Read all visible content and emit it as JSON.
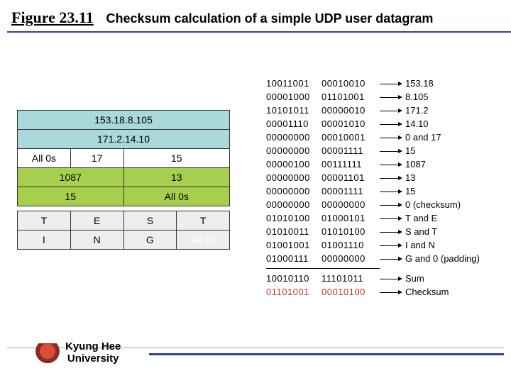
{
  "title": {
    "figure_label": "Figure 23.11",
    "caption": "Checksum calculation of a simple UDP user datagram"
  },
  "packet": {
    "src_ip": "153.18.8.105",
    "dst_ip": "171.2.14.10",
    "row3": {
      "a": "All 0s",
      "b": "17",
      "c": "15"
    },
    "row4": {
      "a": "1087",
      "b": "13"
    },
    "row5": {
      "a": "15",
      "b": "All 0s"
    },
    "data1": {
      "a": "T",
      "b": "E",
      "c": "S",
      "d": "T"
    },
    "data2": {
      "a": "I",
      "b": "N",
      "c": "G",
      "d": "All 0s"
    }
  },
  "bin": [
    {
      "a": "10011001",
      "b": "00010010",
      "m": "153.18"
    },
    {
      "a": "00001000",
      "b": "01101001",
      "m": "8.105"
    },
    {
      "a": "10101011",
      "b": "00000010",
      "m": "171.2"
    },
    {
      "a": "00001110",
      "b": "00001010",
      "m": "14.10"
    },
    {
      "a": "00000000",
      "b": "00010001",
      "m": "0 and 17"
    },
    {
      "a": "00000000",
      "b": "00001111",
      "m": "15"
    },
    {
      "a": "00000100",
      "b": "00111111",
      "m": "1087"
    },
    {
      "a": "00000000",
      "b": "00001101",
      "m": "13"
    },
    {
      "a": "00000000",
      "b": "00001111",
      "m": "15"
    },
    {
      "a": "00000000",
      "b": "00000000",
      "m": "0 (checksum)"
    },
    {
      "a": "01010100",
      "b": "01000101",
      "m": "T and E"
    },
    {
      "a": "01010011",
      "b": "01010100",
      "m": "S and T"
    },
    {
      "a": "01001001",
      "b": "01001110",
      "m": "I and N"
    },
    {
      "a": "01000111",
      "b": "00000000",
      "m": "G and 0 (padding)"
    }
  ],
  "sum": {
    "a": "10010110",
    "b": "11101011",
    "m": "Sum"
  },
  "checksum": {
    "a": "01101001",
    "b": "00010100",
    "m": "Checksum"
  },
  "footer": {
    "uni_line1": "Kyung Hee",
    "uni_line2": "University"
  }
}
